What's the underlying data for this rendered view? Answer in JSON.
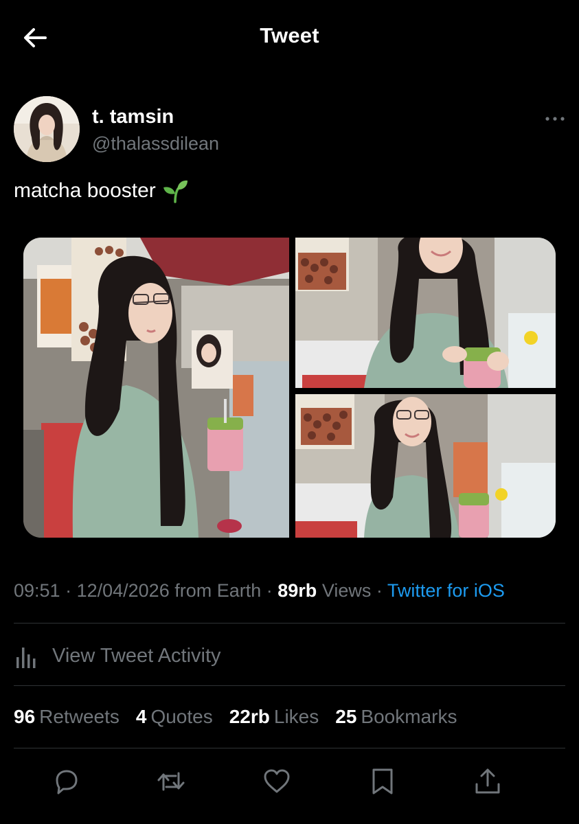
{
  "header": {
    "title": "Tweet",
    "back_icon": "arrow-left-icon"
  },
  "author": {
    "display_name": "t. tamsin",
    "handle": "@thalassdilean",
    "avatar_icon": "avatar-photo",
    "more_icon": "more-horizontal-icon"
  },
  "tweet": {
    "text": "matcha booster",
    "emoji_icon": "seedling-emoji"
  },
  "media": {
    "photos": [
      {
        "name": "photo-1"
      },
      {
        "name": "photo-2"
      },
      {
        "name": "photo-3"
      }
    ]
  },
  "meta": {
    "time": "09:51",
    "sep1": " · ",
    "date": "12/04/2026",
    "from": " from Earth",
    "sep2": " · ",
    "views_count": "89rb",
    "views_label": " Views",
    "sep3": " · ",
    "client": "Twitter for iOS"
  },
  "activity": {
    "label": "View Tweet Activity",
    "icon": "bar-chart-icon"
  },
  "stats": {
    "retweets_count": "96",
    "retweets_label": "Retweets",
    "quotes_count": "4",
    "quotes_label": "Quotes",
    "likes_count": "22rb",
    "likes_label": "Likes",
    "bookmarks_count": "25",
    "bookmarks_label": "Bookmarks"
  },
  "actions": {
    "icons": [
      "reply-icon",
      "retweet-icon",
      "like-icon",
      "bookmark-icon",
      "share-icon"
    ]
  },
  "colors": {
    "background": "#000000",
    "text_primary": "#ffffff",
    "text_secondary": "#71767b",
    "link": "#1d9bf0",
    "divider": "#2f3336"
  }
}
